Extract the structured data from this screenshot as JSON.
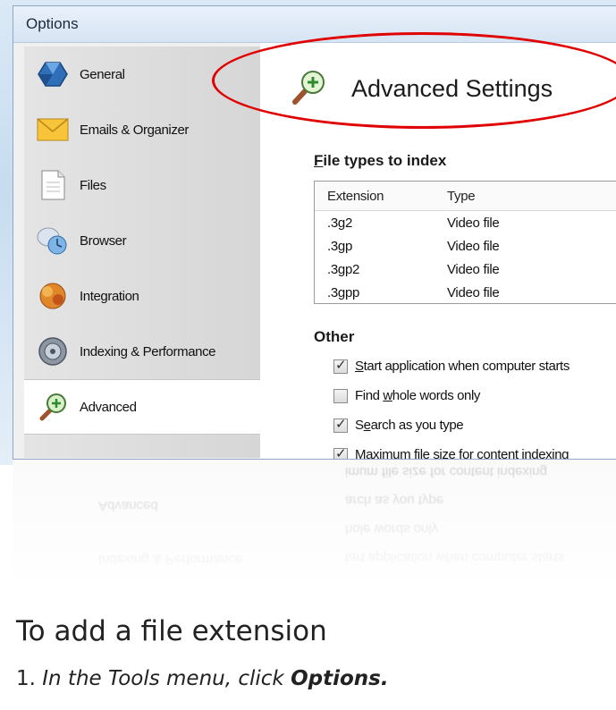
{
  "window": {
    "title": "Options"
  },
  "sidebar": {
    "items": [
      {
        "label": "General",
        "icon": "general-icon"
      },
      {
        "label": "Emails & Organizer",
        "icon": "email-icon"
      },
      {
        "label": "Files",
        "icon": "file-icon"
      },
      {
        "label": "Browser",
        "icon": "browser-icon"
      },
      {
        "label": "Integration",
        "icon": "integration-icon"
      },
      {
        "label": "Indexing & Performance",
        "icon": "indexing-icon"
      },
      {
        "label": "Advanced",
        "icon": "advanced-icon",
        "active": true
      }
    ]
  },
  "content": {
    "header": "Advanced Settings",
    "file_types_title": "File types to index",
    "file_types_accel": "F",
    "file_types_rest": "ile types to index",
    "table": {
      "columns": [
        "Extension",
        "Type"
      ],
      "rows": [
        [
          ".3g2",
          "Video file"
        ],
        [
          ".3gp",
          "Video file"
        ],
        [
          ".3gp2",
          "Video file"
        ],
        [
          ".3gpp",
          "Video file"
        ]
      ]
    },
    "other_title": "Other",
    "options": [
      {
        "pre": "",
        "accel": "S",
        "post": "tart application when computer starts",
        "checked": true
      },
      {
        "pre": "Find ",
        "accel": "w",
        "post": "hole words only",
        "checked": false
      },
      {
        "pre": "S",
        "accel": "e",
        "post": "arch as you type",
        "checked": true
      },
      {
        "pre": "Ma",
        "accel": "x",
        "post": "imum file size for content indexing",
        "checked": true
      }
    ]
  },
  "annotation_color": "#e00000",
  "instructions": {
    "heading": "To add a file extension",
    "step_number": "1.",
    "step_text": "In the Tools menu, click",
    "step_bold": "Options."
  }
}
